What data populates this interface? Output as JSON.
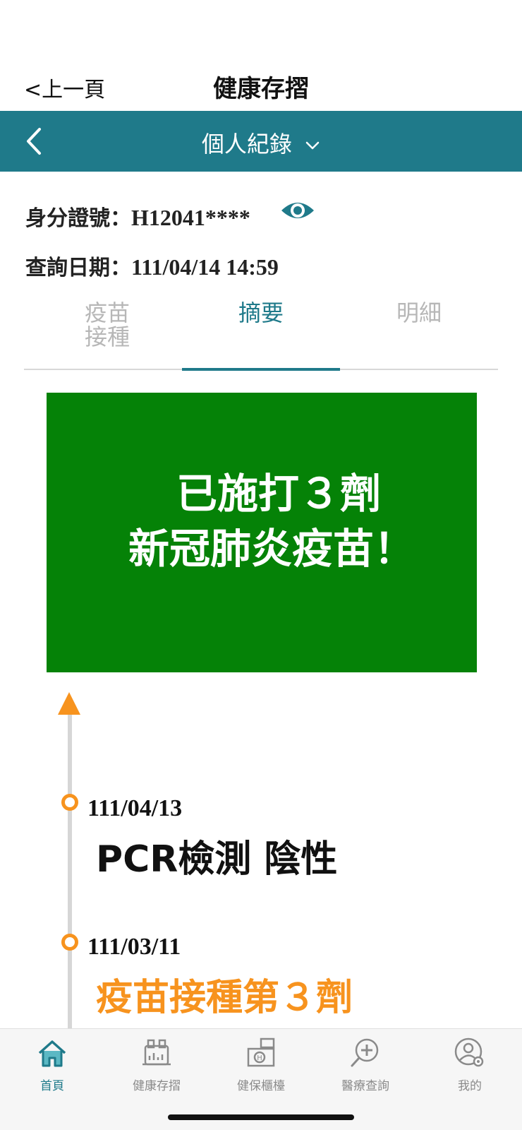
{
  "nav": {
    "back_label": "<上一頁",
    "title": "健康存摺"
  },
  "header": {
    "title": "個人紀錄"
  },
  "info": {
    "id_label": "身分證號：",
    "id_value": "H12041****",
    "date_label": "查詢日期：",
    "date_value": "111/04/14 14:59"
  },
  "tabs": [
    {
      "label": "疫苗接種"
    },
    {
      "label": "摘要"
    },
    {
      "label": "明細"
    }
  ],
  "banner": {
    "line1": "已施打３劑",
    "line2": "新冠肺炎疫苗！",
    "color": "#058207"
  },
  "timeline": [
    {
      "date": "111/04/13",
      "event": "PCR檢測 陰性"
    },
    {
      "date": "111/03/11",
      "event": "疫苗接種第３劑"
    }
  ],
  "tabbar": [
    {
      "label": "首頁",
      "icon": "home-icon"
    },
    {
      "label": "健康存摺",
      "icon": "health-passbook-icon"
    },
    {
      "label": "健保櫃檯",
      "icon": "insurance-counter-icon"
    },
    {
      "label": "醫療查詢",
      "icon": "medical-search-icon"
    },
    {
      "label": "我的",
      "icon": "profile-settings-icon"
    }
  ],
  "colors": {
    "primary": "#1f7a8a",
    "accent": "#f7931e",
    "banner": "#058207"
  }
}
